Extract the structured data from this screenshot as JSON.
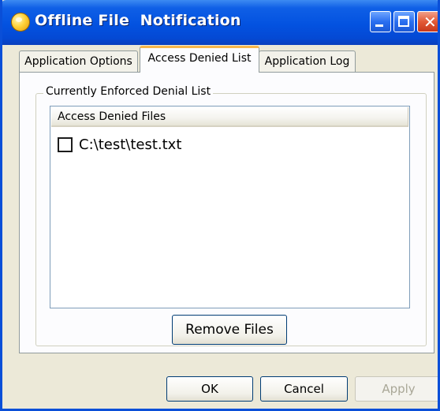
{
  "window": {
    "title": "Offline File  Notification"
  },
  "tabs": [
    {
      "label": "Application Options"
    },
    {
      "label": "Access Denied List"
    },
    {
      "label": "Application Log"
    }
  ],
  "group": {
    "label": "Currently Enforced Denial List"
  },
  "list": {
    "column_header": "Access Denied Files",
    "items": [
      {
        "label": "C:\\test\\test.txt",
        "checked": false
      }
    ]
  },
  "buttons": {
    "remove": "Remove Files",
    "ok": "OK",
    "cancel": "Cancel",
    "apply": "Apply"
  },
  "icons": {
    "app": "app-icon",
    "minimize": "minimize-icon",
    "maximize": "maximize-icon",
    "close": "close-icon"
  },
  "colors": {
    "title_bar": "#0352e0",
    "dialog_bg": "#ece9d8",
    "active_tab_accent": "#f7b64a"
  }
}
